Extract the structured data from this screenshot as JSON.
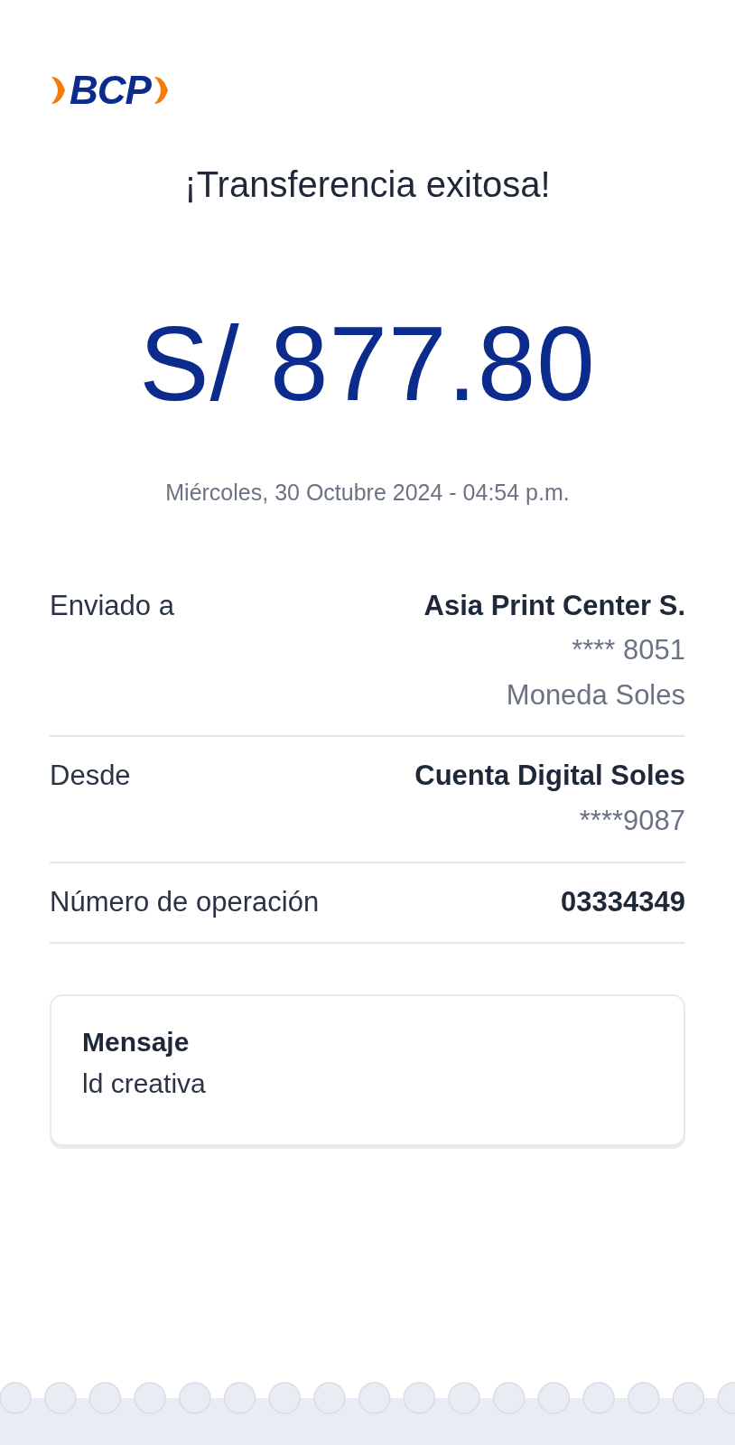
{
  "logo": {
    "text": "BCP"
  },
  "title": "¡Transferencia exitosa!",
  "amount": "S/ 877.80",
  "datetime": "Miércoles, 30 Octubre 2024 - 04:54 p.m.",
  "details": [
    {
      "label": "Enviado a",
      "values": [
        {
          "text": "Asia Print Center S.",
          "kind": "strong"
        },
        {
          "text": "**** 8051",
          "kind": "muted"
        },
        {
          "text": "Moneda Soles",
          "kind": "muted"
        }
      ]
    },
    {
      "label": "Desde",
      "values": [
        {
          "text": "Cuenta Digital Soles",
          "kind": "strong"
        },
        {
          "text": "****9087",
          "kind": "muted"
        }
      ]
    },
    {
      "label": "Número de operación",
      "values": [
        {
          "text": "03334349",
          "kind": "strong"
        }
      ]
    }
  ],
  "message": {
    "label": "Mensaje",
    "text": "ld creativa"
  }
}
